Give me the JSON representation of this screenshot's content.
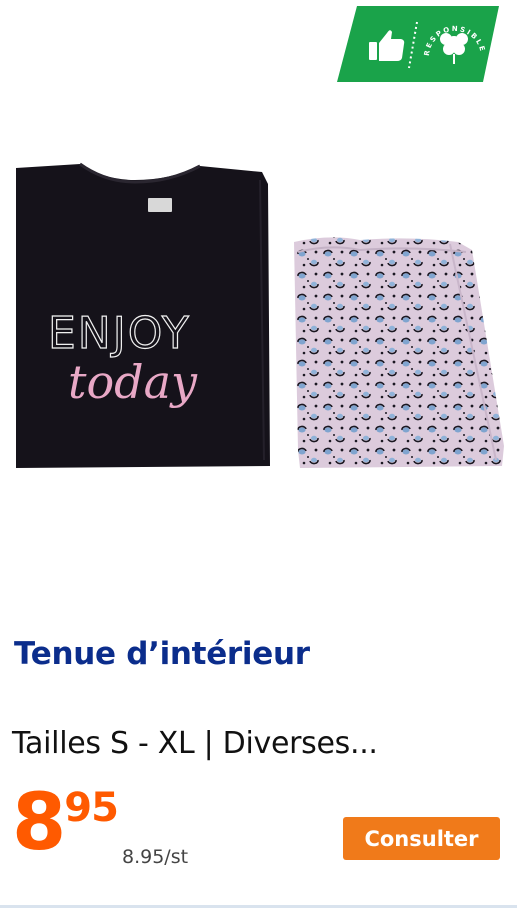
{
  "badge": {
    "icon": "thumbs-up-icon",
    "arc_text": "RESPONSIBLE COTTON",
    "color": "#1aa34a"
  },
  "product": {
    "top_text_line1": "ENJOY",
    "top_text_line2": "today",
    "top_color": "#15121a",
    "print_color": "#e8a8c6",
    "bottom_color": "#d9c7d8"
  },
  "title": "Tenue d’intérieur",
  "subtitle": "Tailles S - XL | Diverses...",
  "price": {
    "integer": "8",
    "decimals": "95",
    "unit_price": "8.95/st",
    "color": "#ff5a00"
  },
  "button": {
    "label": "Consulter",
    "color": "#f07a1a"
  },
  "colors": {
    "title": "#0b2d8c"
  }
}
